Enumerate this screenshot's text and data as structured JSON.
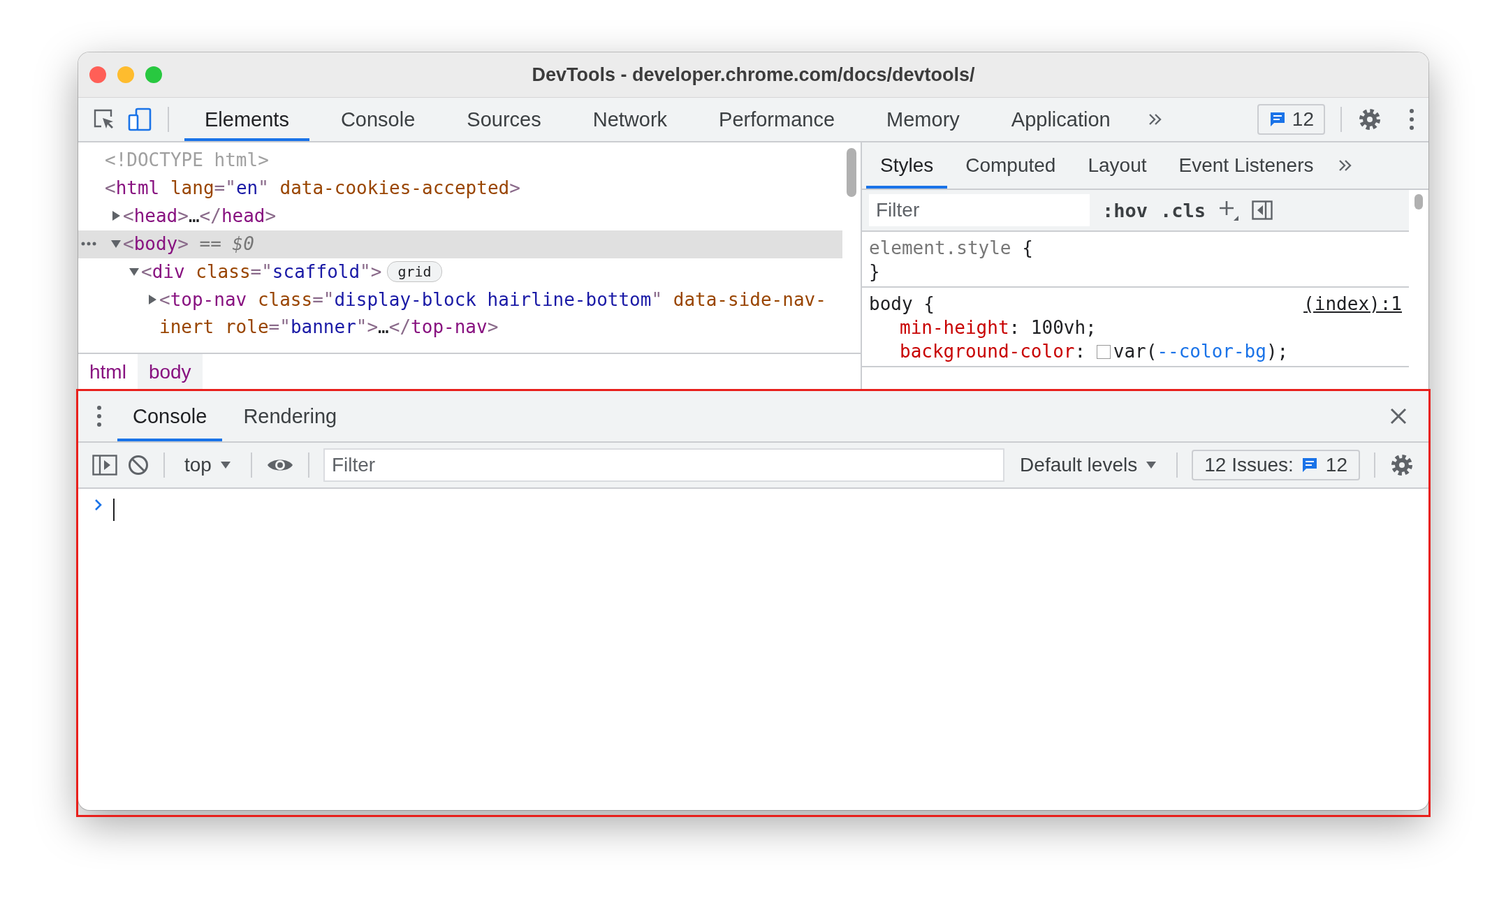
{
  "window": {
    "title": "DevTools - developer.chrome.com/docs/devtools/"
  },
  "main_tabs": [
    {
      "label": "Elements",
      "selected": true
    },
    {
      "label": "Console",
      "selected": false
    },
    {
      "label": "Sources",
      "selected": false
    },
    {
      "label": "Network",
      "selected": false
    },
    {
      "label": "Performance",
      "selected": false
    },
    {
      "label": "Memory",
      "selected": false
    },
    {
      "label": "Application",
      "selected": false
    }
  ],
  "issues_badge": {
    "count": "12"
  },
  "dom_tree": [
    {
      "selected": false,
      "tokens": [
        {
          "kind": "doctype",
          "text": "<!DOCTYPE html>"
        }
      ]
    },
    {
      "selected": false,
      "tokens": [
        {
          "kind": "punct",
          "text": "<"
        },
        {
          "kind": "tag",
          "text": "html"
        },
        {
          "kind": "attr",
          "text": " lang"
        },
        {
          "kind": "punct",
          "text": "=\""
        },
        {
          "kind": "value",
          "text": "en"
        },
        {
          "kind": "punct",
          "text": "\""
        },
        {
          "kind": "attr",
          "text": " data-cookies-accepted"
        },
        {
          "kind": "punct",
          "text": ">"
        }
      ],
      "children": [
        {
          "expanded": false,
          "selected": false,
          "tokens": [
            {
              "kind": "punct",
              "text": "<"
            },
            {
              "kind": "tag",
              "text": "head"
            },
            {
              "kind": "punct",
              "text": ">"
            },
            {
              "kind": "text",
              "text": "…"
            },
            {
              "kind": "punct",
              "text": "</"
            },
            {
              "kind": "tag",
              "text": "head"
            },
            {
              "kind": "punct",
              "text": ">"
            }
          ]
        },
        {
          "expanded": true,
          "selected": true,
          "tokens": [
            {
              "kind": "punct",
              "text": "<"
            },
            {
              "kind": "tag",
              "text": "body"
            },
            {
              "kind": "punct",
              "text": ">"
            },
            {
              "kind": "hint",
              "text": " == "
            },
            {
              "kind": "hint-italic",
              "text": "$0"
            }
          ],
          "children": [
            {
              "expanded": true,
              "selected": false,
              "badge": "grid",
              "tokens": [
                {
                  "kind": "punct",
                  "text": "<"
                },
                {
                  "kind": "tag",
                  "text": "div"
                },
                {
                  "kind": "attr",
                  "text": " class"
                },
                {
                  "kind": "punct",
                  "text": "=\""
                },
                {
                  "kind": "value",
                  "text": "scaffold"
                },
                {
                  "kind": "punct",
                  "text": "\">"
                }
              ],
              "children": [
                {
                  "expanded": false,
                  "selected": false,
                  "tokens": [
                    {
                      "kind": "punct",
                      "text": "<"
                    },
                    {
                      "kind": "tag",
                      "text": "top-nav"
                    },
                    {
                      "kind": "attr",
                      "text": " class"
                    },
                    {
                      "kind": "punct",
                      "text": "=\""
                    },
                    {
                      "kind": "value",
                      "text": "display-block hairline-bottom"
                    },
                    {
                      "kind": "punct",
                      "text": "\""
                    },
                    {
                      "kind": "attr",
                      "text": " data-side-nav-inert"
                    },
                    {
                      "kind": "attr",
                      "text": " role"
                    },
                    {
                      "kind": "punct",
                      "text": "=\""
                    },
                    {
                      "kind": "value",
                      "text": "banner"
                    },
                    {
                      "kind": "punct",
                      "text": "\">"
                    },
                    {
                      "kind": "text",
                      "text": "…"
                    },
                    {
                      "kind": "punct",
                      "text": "</"
                    },
                    {
                      "kind": "tag",
                      "text": "top-nav"
                    },
                    {
                      "kind": "punct",
                      "text": ">"
                    }
                  ]
                }
              ]
            }
          ]
        }
      ]
    }
  ],
  "breadcrumbs": [
    {
      "label": "html",
      "selected": false
    },
    {
      "label": "body",
      "selected": true
    }
  ],
  "styles_tabs": [
    {
      "label": "Styles",
      "selected": true
    },
    {
      "label": "Computed",
      "selected": false
    },
    {
      "label": "Layout",
      "selected": false
    },
    {
      "label": "Event Listeners",
      "selected": false
    }
  ],
  "styles_filter": {
    "placeholder": "Filter",
    "hov": ":hov",
    "cls": ".cls"
  },
  "style_rules": [
    {
      "header": [
        {
          "kind": "inline-selector",
          "text": "element.style"
        },
        {
          "kind": "plain",
          "text": " {"
        }
      ],
      "footer": "}"
    },
    {
      "header": [
        {
          "kind": "selector",
          "text": "body"
        },
        {
          "kind": "plain",
          "text": " {"
        }
      ],
      "source": "(index):1",
      "declarations": [
        [
          {
            "kind": "prop",
            "text": "min-height"
          },
          {
            "kind": "plain",
            "text": ": 100vh;"
          }
        ],
        [
          {
            "kind": "prop",
            "text": "background-color"
          },
          {
            "kind": "plain",
            "text": ": "
          },
          {
            "kind": "swatch",
            "color": "#ffffff"
          },
          {
            "kind": "plain",
            "text": "var("
          },
          {
            "kind": "var",
            "text": "--color-bg"
          },
          {
            "kind": "plain",
            "text": ");"
          }
        ]
      ]
    }
  ],
  "drawer": {
    "highlighted": true,
    "tabs": [
      {
        "label": "Console",
        "selected": true
      },
      {
        "label": "Rendering",
        "selected": false
      }
    ],
    "context": "top",
    "filter_placeholder": "Filter",
    "levels": "Default levels",
    "issues": {
      "label": "12 Issues:",
      "count": "12"
    }
  }
}
